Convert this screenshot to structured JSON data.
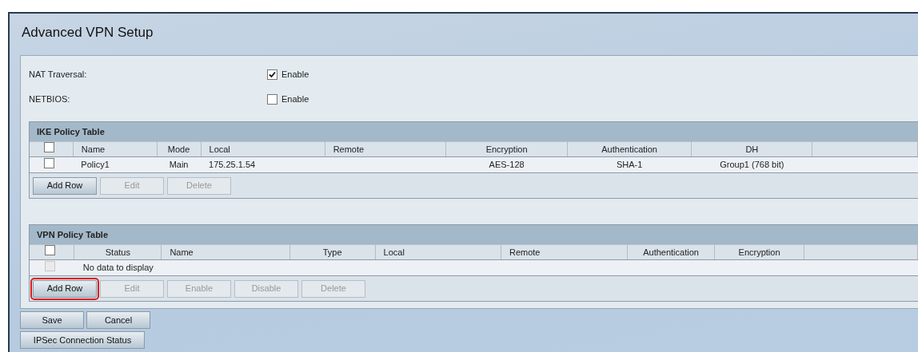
{
  "page_title": "Advanced VPN Setup",
  "settings": [
    {
      "label": "NAT Traversal:",
      "option": "Enable",
      "checked": true
    },
    {
      "label": "NETBIOS:",
      "option": "Enable",
      "checked": false
    }
  ],
  "ike_table": {
    "title": "IKE Policy Table",
    "select_all": {
      "checked": false,
      "disabled": false
    },
    "columns": [
      {
        "label": "Name",
        "kind": "left"
      },
      {
        "label": "Mode",
        "kind": "center"
      },
      {
        "label": "Local",
        "kind": "left"
      },
      {
        "label": "Remote",
        "kind": "left"
      },
      {
        "label": "Encryption",
        "kind": "center"
      },
      {
        "label": "Authentication",
        "kind": "center"
      },
      {
        "label": "DH",
        "kind": "center"
      }
    ],
    "rows": [
      {
        "checked": false,
        "cells": [
          "Policy1",
          "Main",
          "175.25.1.54",
          "",
          "AES-128",
          "SHA-1",
          "Group1 (768 bit)"
        ]
      }
    ],
    "buttons": [
      {
        "label": "Add Row",
        "disabled": false,
        "highlighted": false
      },
      {
        "label": "Edit",
        "disabled": true,
        "highlighted": false
      },
      {
        "label": "Delete",
        "disabled": true,
        "highlighted": false
      }
    ]
  },
  "vpn_table": {
    "title": "VPN Policy Table",
    "select_all": {
      "checked": false,
      "disabled": false
    },
    "columns": [
      {
        "label": "Status",
        "kind": "center"
      },
      {
        "label": "Name",
        "kind": "left"
      },
      {
        "label": "Type",
        "kind": "center"
      },
      {
        "label": "Local",
        "kind": "left"
      },
      {
        "label": "Remote",
        "kind": "left"
      },
      {
        "label": "Authentication",
        "kind": "center"
      },
      {
        "label": "Encryption",
        "kind": "center"
      }
    ],
    "empty_row": {
      "message": "No data to display",
      "checked": false,
      "disabled": true
    },
    "buttons": [
      {
        "label": "Add Row",
        "disabled": false,
        "highlighted": true
      },
      {
        "label": "Edit",
        "disabled": true,
        "highlighted": false
      },
      {
        "label": "Enable",
        "disabled": true,
        "highlighted": false
      },
      {
        "label": "Disable",
        "disabled": true,
        "highlighted": false
      },
      {
        "label": "Delete",
        "disabled": true,
        "highlighted": false
      }
    ]
  },
  "actions": [
    {
      "label": "Save"
    },
    {
      "label": "Cancel"
    }
  ],
  "status_button": {
    "label": "IPSec Connection Status"
  }
}
